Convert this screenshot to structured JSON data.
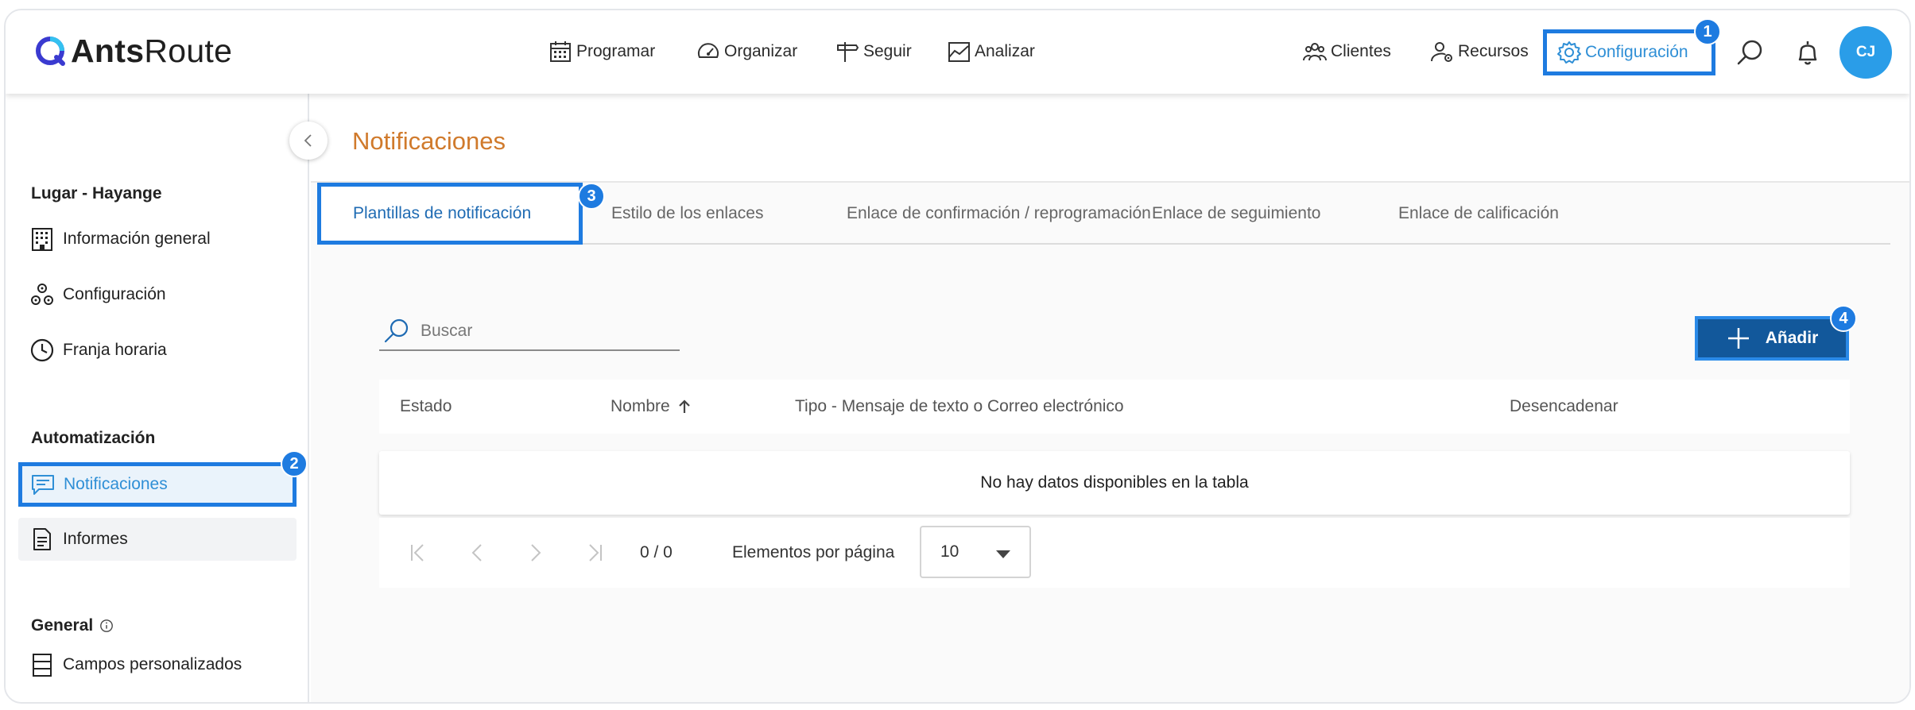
{
  "app": {
    "logo_bold": "Ants",
    "logo_regular": "Route"
  },
  "nav": {
    "programar": "Programar",
    "organizar": "Organizar",
    "seguir": "Seguir",
    "analizar": "Analizar",
    "clientes": "Clientes",
    "recursos": "Recursos",
    "configuracion": "Configuración",
    "avatar_initials": "CJ"
  },
  "badges": {
    "b1": "1",
    "b2": "2",
    "b3": "3",
    "b4": "4"
  },
  "sidebar": {
    "section_lugar": "Lugar - Hayange",
    "items_lugar": [
      "Información general",
      "Configuración",
      "Franja horaria"
    ],
    "section_automatizacion": "Automatización",
    "items_auto": [
      "Notificaciones",
      "Informes"
    ],
    "section_general": "General",
    "items_general": [
      "Campos personalizados"
    ]
  },
  "main": {
    "page_title": "Notificaciones",
    "tabs": [
      "Plantillas de notificación",
      "Estilo de los enlaces",
      "Enlace de confirmación / reprogramación",
      "Enlace de seguimiento",
      "Enlace de calificación"
    ],
    "search_placeholder": "Buscar",
    "add_label": "Añadir",
    "columns": [
      "Estado",
      "Nombre",
      "Tipo - Mensaje de texto o Correo electrónico",
      "Desencadenar"
    ],
    "empty_message": "No hay datos disponibles en la tabla",
    "pager_count": "0 / 0",
    "pager_label": "Elementos por página",
    "page_size": "10"
  },
  "colors": {
    "accent": "#1e7be0",
    "link_blue": "#2f8fd6",
    "title_orange": "#d07a2c",
    "button_dark": "#12589b",
    "avatar": "#2a9de8"
  }
}
